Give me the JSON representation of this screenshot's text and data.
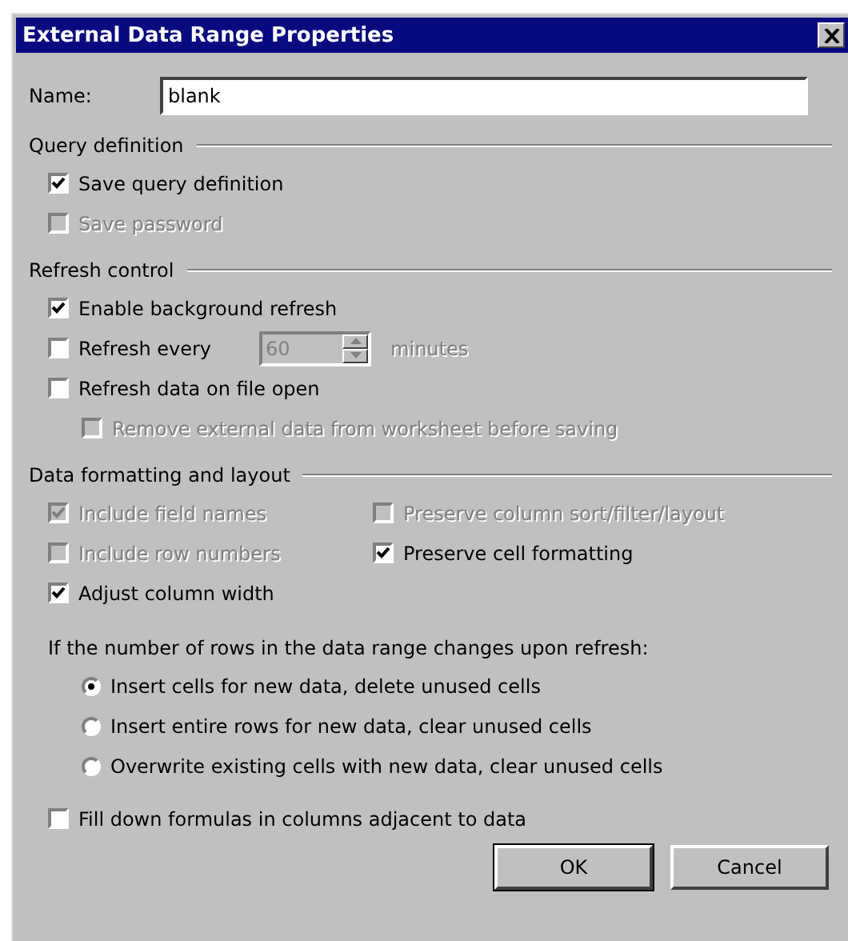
{
  "window": {
    "title": "External Data Range Properties"
  },
  "name_field": {
    "label": "Name:",
    "value": "blank"
  },
  "sections": [
    {
      "title": "Query definition",
      "items": [
        {
          "kind": "checkbox",
          "label": "Save query definition",
          "checked": true,
          "disabled": false
        },
        {
          "kind": "checkbox",
          "label": "Save password",
          "checked": false,
          "disabled": true
        }
      ]
    },
    {
      "title": "Refresh control",
      "items": [
        {
          "kind": "checkbox",
          "label": "Enable background refresh",
          "checked": true,
          "disabled": false
        },
        {
          "kind": "checkbox_spinner",
          "label": "Refresh every",
          "checked": false,
          "disabled": false,
          "spinner": {
            "value": "60",
            "disabled": true
          },
          "unit": "minutes"
        },
        {
          "kind": "checkbox",
          "label": "Refresh data on file open",
          "checked": false,
          "disabled": false,
          "children": [
            {
              "label": "Remove external data from worksheet before saving",
              "checked": false,
              "disabled": true
            }
          ]
        }
      ]
    },
    {
      "title": "Data formatting and layout",
      "grid": [
        [
          {
            "label": "Include field names",
            "checked": true,
            "disabled": true
          },
          {
            "label": "Preserve column sort/filter/layout",
            "checked": false,
            "disabled": true
          }
        ],
        [
          {
            "label": "Include row numbers",
            "checked": false,
            "disabled": true
          },
          {
            "label": "Preserve cell formatting",
            "checked": true,
            "disabled": false
          }
        ],
        [
          {
            "label": "Adjust column width",
            "checked": true,
            "disabled": false
          }
        ]
      ],
      "prompt": "If the number of rows in the data range changes upon refresh:",
      "options": [
        {
          "label": "Insert cells for new data, delete unused cells",
          "selected": true
        },
        {
          "label": "Insert entire rows for new data, clear unused cells",
          "selected": false
        },
        {
          "label": "Overwrite existing cells with new data, clear unused cells",
          "selected": false
        }
      ],
      "after": [
        {
          "label": "Fill down formulas in columns adjacent to data",
          "checked": false,
          "disabled": false
        }
      ]
    }
  ],
  "buttons": [
    {
      "label": "OK",
      "default": true
    },
    {
      "label": "Cancel",
      "default": false
    }
  ]
}
